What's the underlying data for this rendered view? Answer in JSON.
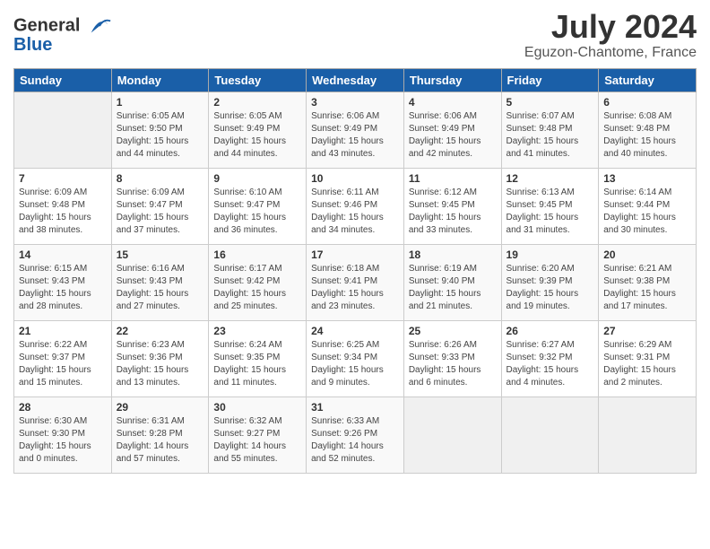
{
  "logo": {
    "line1": "General",
    "line2": "Blue"
  },
  "title": "July 2024",
  "location": "Eguzon-Chantome, France",
  "headers": [
    "Sunday",
    "Monday",
    "Tuesday",
    "Wednesday",
    "Thursday",
    "Friday",
    "Saturday"
  ],
  "weeks": [
    [
      {
        "day": "",
        "sunrise": "",
        "sunset": "",
        "daylight": ""
      },
      {
        "day": "1",
        "sunrise": "Sunrise: 6:05 AM",
        "sunset": "Sunset: 9:50 PM",
        "daylight": "Daylight: 15 hours and 44 minutes."
      },
      {
        "day": "2",
        "sunrise": "Sunrise: 6:05 AM",
        "sunset": "Sunset: 9:49 PM",
        "daylight": "Daylight: 15 hours and 44 minutes."
      },
      {
        "day": "3",
        "sunrise": "Sunrise: 6:06 AM",
        "sunset": "Sunset: 9:49 PM",
        "daylight": "Daylight: 15 hours and 43 minutes."
      },
      {
        "day": "4",
        "sunrise": "Sunrise: 6:06 AM",
        "sunset": "Sunset: 9:49 PM",
        "daylight": "Daylight: 15 hours and 42 minutes."
      },
      {
        "day": "5",
        "sunrise": "Sunrise: 6:07 AM",
        "sunset": "Sunset: 9:48 PM",
        "daylight": "Daylight: 15 hours and 41 minutes."
      },
      {
        "day": "6",
        "sunrise": "Sunrise: 6:08 AM",
        "sunset": "Sunset: 9:48 PM",
        "daylight": "Daylight: 15 hours and 40 minutes."
      }
    ],
    [
      {
        "day": "7",
        "sunrise": "Sunrise: 6:09 AM",
        "sunset": "Sunset: 9:48 PM",
        "daylight": "Daylight: 15 hours and 38 minutes."
      },
      {
        "day": "8",
        "sunrise": "Sunrise: 6:09 AM",
        "sunset": "Sunset: 9:47 PM",
        "daylight": "Daylight: 15 hours and 37 minutes."
      },
      {
        "day": "9",
        "sunrise": "Sunrise: 6:10 AM",
        "sunset": "Sunset: 9:47 PM",
        "daylight": "Daylight: 15 hours and 36 minutes."
      },
      {
        "day": "10",
        "sunrise": "Sunrise: 6:11 AM",
        "sunset": "Sunset: 9:46 PM",
        "daylight": "Daylight: 15 hours and 34 minutes."
      },
      {
        "day": "11",
        "sunrise": "Sunrise: 6:12 AM",
        "sunset": "Sunset: 9:45 PM",
        "daylight": "Daylight: 15 hours and 33 minutes."
      },
      {
        "day": "12",
        "sunrise": "Sunrise: 6:13 AM",
        "sunset": "Sunset: 9:45 PM",
        "daylight": "Daylight: 15 hours and 31 minutes."
      },
      {
        "day": "13",
        "sunrise": "Sunrise: 6:14 AM",
        "sunset": "Sunset: 9:44 PM",
        "daylight": "Daylight: 15 hours and 30 minutes."
      }
    ],
    [
      {
        "day": "14",
        "sunrise": "Sunrise: 6:15 AM",
        "sunset": "Sunset: 9:43 PM",
        "daylight": "Daylight: 15 hours and 28 minutes."
      },
      {
        "day": "15",
        "sunrise": "Sunrise: 6:16 AM",
        "sunset": "Sunset: 9:43 PM",
        "daylight": "Daylight: 15 hours and 27 minutes."
      },
      {
        "day": "16",
        "sunrise": "Sunrise: 6:17 AM",
        "sunset": "Sunset: 9:42 PM",
        "daylight": "Daylight: 15 hours and 25 minutes."
      },
      {
        "day": "17",
        "sunrise": "Sunrise: 6:18 AM",
        "sunset": "Sunset: 9:41 PM",
        "daylight": "Daylight: 15 hours and 23 minutes."
      },
      {
        "day": "18",
        "sunrise": "Sunrise: 6:19 AM",
        "sunset": "Sunset: 9:40 PM",
        "daylight": "Daylight: 15 hours and 21 minutes."
      },
      {
        "day": "19",
        "sunrise": "Sunrise: 6:20 AM",
        "sunset": "Sunset: 9:39 PM",
        "daylight": "Daylight: 15 hours and 19 minutes."
      },
      {
        "day": "20",
        "sunrise": "Sunrise: 6:21 AM",
        "sunset": "Sunset: 9:38 PM",
        "daylight": "Daylight: 15 hours and 17 minutes."
      }
    ],
    [
      {
        "day": "21",
        "sunrise": "Sunrise: 6:22 AM",
        "sunset": "Sunset: 9:37 PM",
        "daylight": "Daylight: 15 hours and 15 minutes."
      },
      {
        "day": "22",
        "sunrise": "Sunrise: 6:23 AM",
        "sunset": "Sunset: 9:36 PM",
        "daylight": "Daylight: 15 hours and 13 minutes."
      },
      {
        "day": "23",
        "sunrise": "Sunrise: 6:24 AM",
        "sunset": "Sunset: 9:35 PM",
        "daylight": "Daylight: 15 hours and 11 minutes."
      },
      {
        "day": "24",
        "sunrise": "Sunrise: 6:25 AM",
        "sunset": "Sunset: 9:34 PM",
        "daylight": "Daylight: 15 hours and 9 minutes."
      },
      {
        "day": "25",
        "sunrise": "Sunrise: 6:26 AM",
        "sunset": "Sunset: 9:33 PM",
        "daylight": "Daylight: 15 hours and 6 minutes."
      },
      {
        "day": "26",
        "sunrise": "Sunrise: 6:27 AM",
        "sunset": "Sunset: 9:32 PM",
        "daylight": "Daylight: 15 hours and 4 minutes."
      },
      {
        "day": "27",
        "sunrise": "Sunrise: 6:29 AM",
        "sunset": "Sunset: 9:31 PM",
        "daylight": "Daylight: 15 hours and 2 minutes."
      }
    ],
    [
      {
        "day": "28",
        "sunrise": "Sunrise: 6:30 AM",
        "sunset": "Sunset: 9:30 PM",
        "daylight": "Daylight: 15 hours and 0 minutes."
      },
      {
        "day": "29",
        "sunrise": "Sunrise: 6:31 AM",
        "sunset": "Sunset: 9:28 PM",
        "daylight": "Daylight: 14 hours and 57 minutes."
      },
      {
        "day": "30",
        "sunrise": "Sunrise: 6:32 AM",
        "sunset": "Sunset: 9:27 PM",
        "daylight": "Daylight: 14 hours and 55 minutes."
      },
      {
        "day": "31",
        "sunrise": "Sunrise: 6:33 AM",
        "sunset": "Sunset: 9:26 PM",
        "daylight": "Daylight: 14 hours and 52 minutes."
      },
      {
        "day": "",
        "sunrise": "",
        "sunset": "",
        "daylight": ""
      },
      {
        "day": "",
        "sunrise": "",
        "sunset": "",
        "daylight": ""
      },
      {
        "day": "",
        "sunrise": "",
        "sunset": "",
        "daylight": ""
      }
    ]
  ]
}
